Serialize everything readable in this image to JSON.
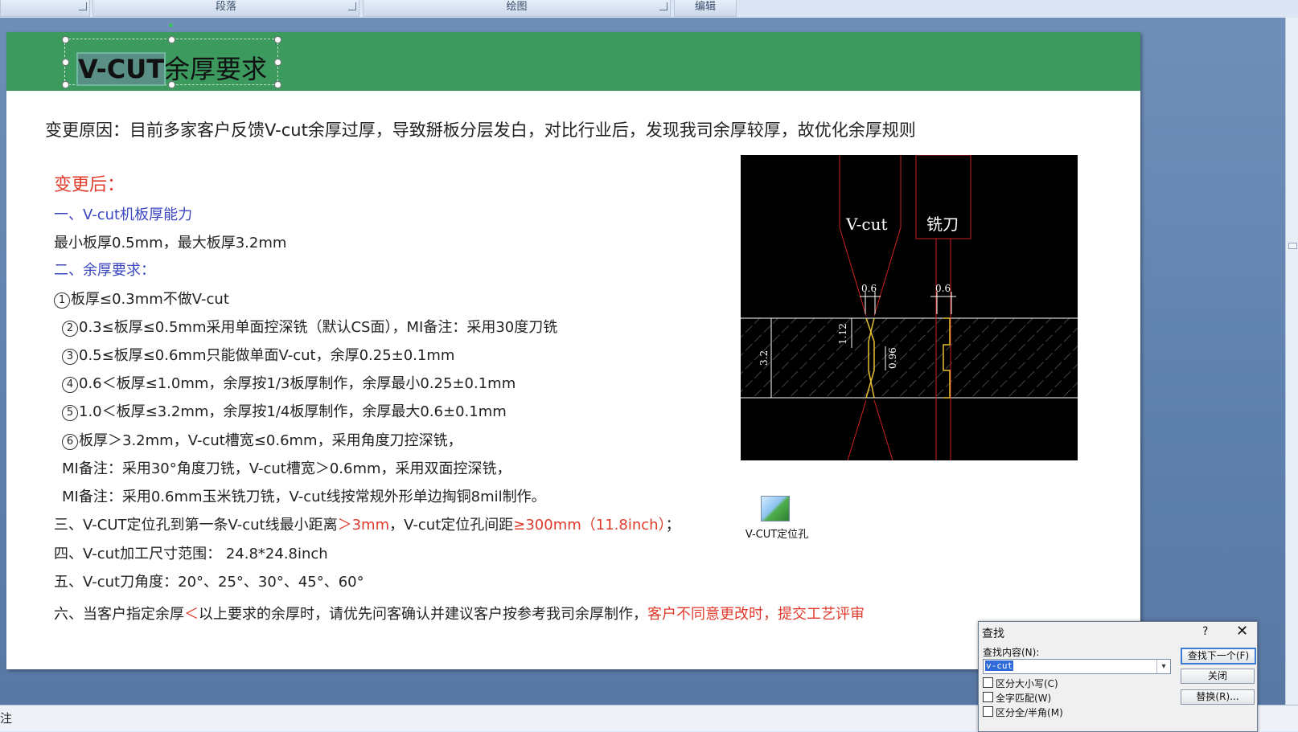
{
  "ribbon": {
    "groups": [
      "段落",
      "绘图",
      "编辑"
    ]
  },
  "slide": {
    "title_selected": "V-CUT",
    "title_rest": "余厚要求",
    "reason": "变更原因：目前多家客户反馈V-cut余厚过厚，导致掰板分层发白，对比行业后，发现我司余厚较厚，故优化余厚规则",
    "after_heading": "变更后：",
    "sec1_heading": "一、V-cut机板厚能力",
    "sec1_line": "最小板厚0.5mm，最大板厚3.2mm",
    "sec2_heading": "二、余厚要求：",
    "rules": [
      {
        "num": "1",
        "text": "板厚≤0.3mm不做V-cut"
      },
      {
        "num": "2",
        "text": "0.3≤板厚≤0.5mm采用单面控深铣（默认CS面），MI备注：采用30度刀铣"
      },
      {
        "num": "3",
        "text": "0.5≤板厚≤0.6mm只能做单面V-cut，余厚0.25±0.1mm"
      },
      {
        "num": "4",
        "text": "0.6＜板厚≤1.0mm，余厚按1/3板厚制作，余厚最小0.25±0.1mm"
      },
      {
        "num": "5",
        "text": "1.0＜板厚≤3.2mm，余厚按1/4板厚制作，余厚最大0.6±0.1mm"
      },
      {
        "num": "6",
        "text": "板厚＞3.2mm，V-cut槽宽≤0.6mm，采用角度刀控深铣，"
      }
    ],
    "mi_note1": "MI备注：采用30°角度刀铣，V-cut槽宽＞0.6mm，采用双面控深铣，",
    "mi_note2": "MI备注：采用0.6mm玉米铣刀铣，V-cut线按常规外形单边掏铜8mil制作。",
    "sec3_a": "三、V-CUT定位孔到第一条V-cut线最小距离",
    "sec3_b": "＞3mm",
    "sec3_c": "，V-cut定位孔间距",
    "sec3_d": "≥300mm（11.8inch）",
    "sec3_e": "；",
    "sec4": "四、V-cut加工尺寸范围：  24.8*24.8inch",
    "sec5": "五、V-cut刀角度：20°、25°、30°、45°、60°",
    "sec6_a": "六、当客户指定余厚",
    "sec6_b": "＜",
    "sec6_c": "以上要求的余厚时，请优先问客确认并建议客户按参考我司余厚制作，",
    "sec6_d": "客户不同意更改时，提交工艺评审",
    "embed_label": "V-CUT定位孔"
  },
  "diagram": {
    "label_vcut": "V-cut",
    "label_mill": "铣刀",
    "dim_06_left": "0.6",
    "dim_06_right": "0.6",
    "dim_112": "1.12",
    "dim_096": "0.96",
    "dim_32": "3.2",
    "colors": {
      "background": "#000000",
      "red": "#cc2222",
      "white": "#ffffff",
      "yellow": "#e8c030"
    }
  },
  "find_dialog": {
    "title": "查找",
    "help": "?",
    "close": "✕",
    "find_label": "查找内容(N):",
    "find_value": "v-cut",
    "find_next": "查找下一个(F)",
    "close_btn": "关闭",
    "replace_btn": "替换(R)...",
    "opt1": "区分大小写(C)",
    "opt2": "全字匹配(W)",
    "opt3": "区分全/半角(M)"
  },
  "status": {
    "text": "注"
  },
  "colors": {
    "header_green": "#3c9a5f",
    "red_text": "#e03a2c",
    "blue_text": "#3a46c0"
  }
}
